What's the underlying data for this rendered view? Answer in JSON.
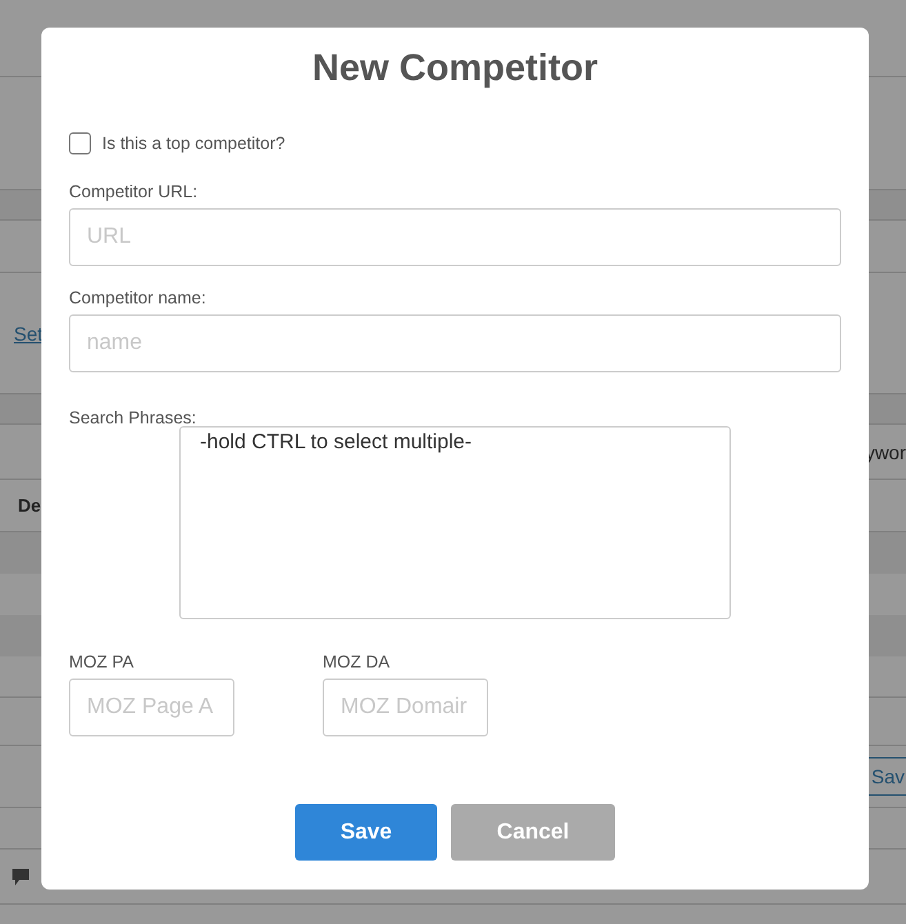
{
  "background_page": {
    "link": "Set",
    "column_header": "De",
    "column_header_right": "ywor",
    "button": "Sav"
  },
  "dialog": {
    "title": "New Competitor",
    "top_competitor": {
      "label": "Is this a top competitor?",
      "checked": false
    },
    "url_field": {
      "label": "Competitor URL:",
      "placeholder": "URL"
    },
    "name_field": {
      "label": "Competitor name:",
      "placeholder": "name"
    },
    "search_phrases": {
      "label": "Search Phrases:",
      "options": [
        "-hold CTRL to select multiple-"
      ]
    },
    "moz_pa": {
      "label": "MOZ PA",
      "placeholder": "MOZ Page A"
    },
    "moz_da": {
      "label": "MOZ DA",
      "placeholder": "MOZ Domair"
    },
    "buttons": [
      {
        "label": "Save",
        "kind": "primary"
      },
      {
        "label": "Cancel",
        "kind": "secondary"
      }
    ]
  }
}
